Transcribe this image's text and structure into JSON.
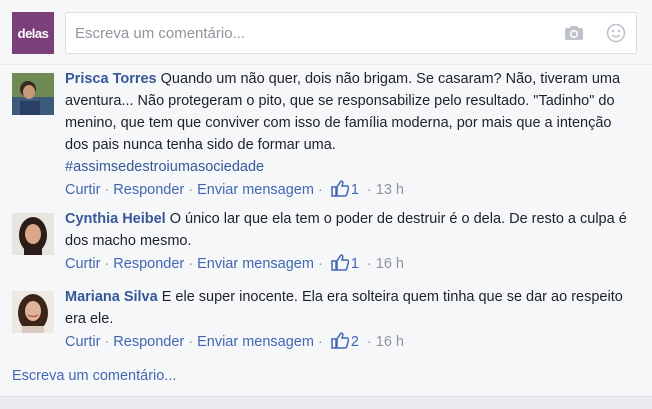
{
  "composer": {
    "brand_text": "delas",
    "placeholder": "Escreva um comentário..."
  },
  "comments": [
    {
      "name": "Prisca Torres",
      "text": "Quando um não quer, dois não brigam. Se casaram? Não, tiveram uma aventura... Não protegeram o pito, que se responsabilize pelo resultado. \"Tadinho\" do menino, que tem que conviver com isso de família moderna, por mais que a intenção dos pais nunca tenha sido de formar uma.",
      "hashtag": "#assimsedestroiumasociedade",
      "like_label": "Curtir",
      "reply_label": "Responder",
      "message_label": "Enviar mensagem",
      "likes": "1",
      "time": "13 h"
    },
    {
      "name": "Cynthia Heibel",
      "text": "O único lar que ela tem o poder de destruir é o dela. De resto a culpa é dos macho mesmo.",
      "hashtag": "",
      "like_label": "Curtir",
      "reply_label": "Responder",
      "message_label": "Enviar mensagem",
      "likes": "1",
      "time": "16 h"
    },
    {
      "name": "Mariana Silva",
      "text": "E ele super inocente. Ela era solteira quem tinha que se dar ao respeito era ele.",
      "hashtag": "",
      "like_label": "Curtir",
      "reply_label": "Responder",
      "message_label": "Enviar mensagem",
      "likes": "2",
      "time": "16 h"
    }
  ],
  "bottom": {
    "write_comment": "Escreva um comentário..."
  },
  "colors": {
    "link": "#365899",
    "action": "#4267b2",
    "meta": "#90949c",
    "brand": "#7b3f7a"
  }
}
